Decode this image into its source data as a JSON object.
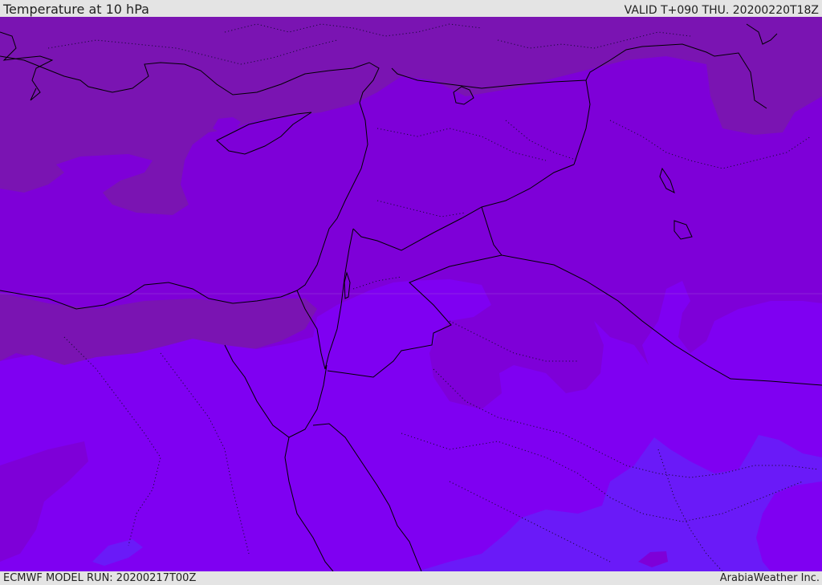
{
  "header": {
    "title": "Temperature at 10 hPa",
    "valid": "VALID T+090 THU. 20200220T18Z"
  },
  "footer": {
    "model_run": "ECMWF MODEL RUN: 20200217T00Z",
    "credit": "ArabiaWeather Inc."
  },
  "colors": {
    "band_coldest": "#7a14b2",
    "band_cold": "#7e00d8",
    "band_mid": "#7f00f2",
    "band_warm": "#6a1af8",
    "coastline": "#000000",
    "background": "#e4e4e4"
  }
}
